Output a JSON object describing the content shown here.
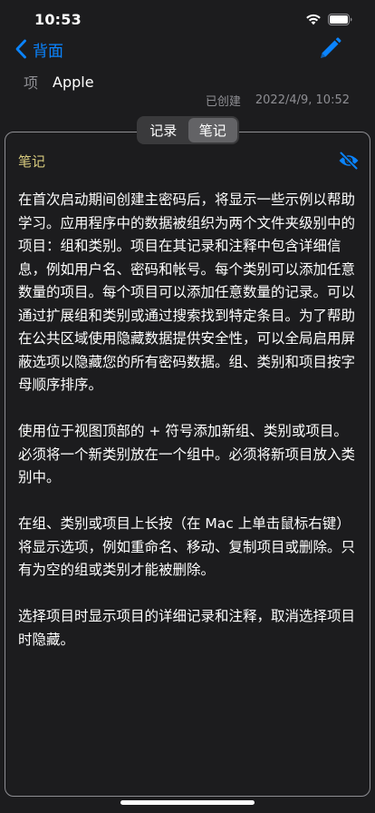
{
  "status_bar": {
    "time": "10:53",
    "wifi_icon": "wifi-icon",
    "battery_icon": "battery-icon"
  },
  "nav": {
    "back_label": "背面",
    "back_icon": "chevron-left-icon",
    "edit_icon": "pencil-icon"
  },
  "item": {
    "label": "项",
    "value": "Apple"
  },
  "created": {
    "label": "已创建",
    "value": "2022/4/9, 10:52"
  },
  "segments": [
    {
      "label": "记录",
      "selected": false
    },
    {
      "label": "笔记",
      "selected": true
    }
  ],
  "note": {
    "heading": "笔记",
    "visibility_icon": "eye-slash-icon",
    "paragraphs": [
      "在首次启动期间创建主密码后，将显示一些示例以帮助学习。应用程序中的数据被组织为两个文件夹级别中的项目：组和类别。项目在其记录和注释中包含详细信息，例如用户名、密码和帐号。每个类别可以添加任意数量的项目。每个项目可以添加任意数量的记录。可以通过扩展组和类别或通过搜索找到特定条目。为了帮助在公共区域使用隐藏数据提供安全性，可以全局启用屏蔽选项以隐藏您的所有密码数据。组、类别和项目按字母顺序排序。",
      "使用位于视图顶部的 + 符号添加新组、类别或项目。必须将一个新类别放在一个组中。必须将新项目放入类别中。",
      "在组、类别或项目上长按（在 Mac 上单击鼠标右键）将显示选项，例如重命名、移动、复制项目或删除。只有为空的组或类别才能被删除。",
      "选择项目时显示项目的详细记录和注释，取消选择项目时隐藏。"
    ]
  },
  "colors": {
    "accent": "#0a84ff",
    "note_heading": "#d6c97d",
    "background": "#1c1c1e",
    "secondary_text": "#8e8e93"
  }
}
